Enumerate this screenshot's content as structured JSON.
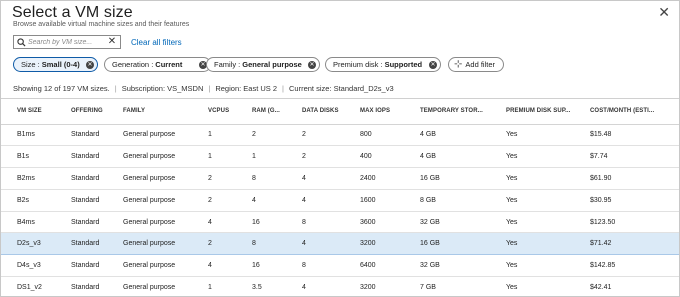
{
  "header": {
    "title": "Select a VM size",
    "subtitle": "Browse available virtual machine sizes and their features",
    "close_glyph": "✕"
  },
  "search": {
    "placeholder": "Search by VM size...",
    "value": "",
    "clear_glyph": "✕",
    "clear_filters_label": "Clear all filters"
  },
  "filters": [
    {
      "label": "Size :",
      "value": "Small (0-4)",
      "active": true
    },
    {
      "label": "Generation :",
      "value": "Current",
      "active": false
    },
    {
      "label": "Family :",
      "value": "General purpose",
      "active": false
    },
    {
      "label": "Premium disk :",
      "value": "Supported",
      "active": false
    }
  ],
  "add_filter_label": "Add filter",
  "info": {
    "showing": "Showing 12 of 197 VM sizes.",
    "subscription": "Subscription: VS_MSDN",
    "region": "Region: East US 2",
    "current_size": "Current size: Standard_D2s_v3"
  },
  "table": {
    "columns": [
      "VM SIZE",
      "OFFERING",
      "FAMILY",
      "VCPUS",
      "RAM (G...",
      "DATA DISKS",
      "MAX IOPS",
      "TEMPORARY STOR...",
      "PREMIUM DISK SUP...",
      "COST/MONTH (ESTI..."
    ],
    "rows": [
      [
        "B1ms",
        "Standard",
        "General purpose",
        "1",
        "2",
        "2",
        "800",
        "4 GB",
        "Yes",
        "$15.48"
      ],
      [
        "B1s",
        "Standard",
        "General purpose",
        "1",
        "1",
        "2",
        "400",
        "4 GB",
        "Yes",
        "$7.74"
      ],
      [
        "B2ms",
        "Standard",
        "General purpose",
        "2",
        "8",
        "4",
        "2400",
        "16 GB",
        "Yes",
        "$61.90"
      ],
      [
        "B2s",
        "Standard",
        "General purpose",
        "2",
        "4",
        "4",
        "1600",
        "8 GB",
        "Yes",
        "$30.95"
      ],
      [
        "B4ms",
        "Standard",
        "General purpose",
        "4",
        "16",
        "8",
        "3600",
        "32 GB",
        "Yes",
        "$123.50"
      ],
      [
        "D2s_v3",
        "Standard",
        "General purpose",
        "2",
        "8",
        "4",
        "3200",
        "16 GB",
        "Yes",
        "$71.42"
      ],
      [
        "D4s_v3",
        "Standard",
        "General purpose",
        "4",
        "16",
        "8",
        "6400",
        "32 GB",
        "Yes",
        "$142.85"
      ],
      [
        "DS1_v2",
        "Standard",
        "General purpose",
        "1",
        "3.5",
        "4",
        "3200",
        "7 GB",
        "Yes",
        "$42.41"
      ]
    ],
    "selected_row": "D2s_v3"
  }
}
